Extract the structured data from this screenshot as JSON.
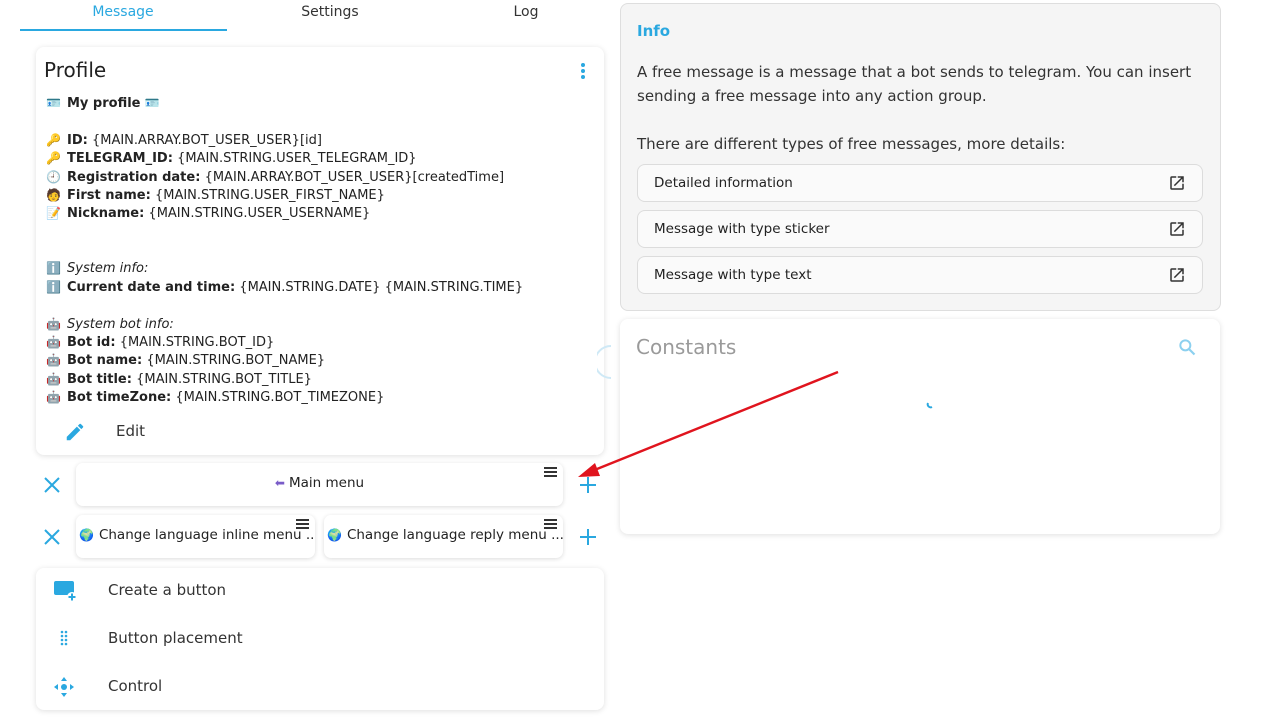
{
  "tabs": {
    "message": "Message",
    "settings": "Settings",
    "log": "Log"
  },
  "profile": {
    "title": "Profile",
    "my_profile": "My profile",
    "lines": {
      "id_label": "ID:",
      "id_value": "{MAIN.ARRAY.BOT_USER_USER}[id]",
      "tg_label": "TELEGRAM_ID:",
      "tg_value": "{MAIN.STRING.USER_TELEGRAM_ID}",
      "reg_label": "Registration date:",
      "reg_value": "{MAIN.ARRAY.BOT_USER_USER}[createdTime]",
      "first_label": "First name:",
      "first_value": "{MAIN.STRING.USER_FIRST_NAME}",
      "nick_label": "Nickname:",
      "nick_value": "{MAIN.STRING.USER_USERNAME}",
      "sys_info": "System info:",
      "cur_label": "Current date and time:",
      "cur_value": "{MAIN.STRING.DATE} {MAIN.STRING.TIME}",
      "sys_bot_info": "System bot info:",
      "botid_label": "Bot id:",
      "botid_value": "{MAIN.STRING.BOT_ID}",
      "botname_label": "Bot name:",
      "botname_value": "{MAIN.STRING.BOT_NAME}",
      "bottitle_label": "Bot title:",
      "bottitle_value": "{MAIN.STRING.BOT_TITLE}",
      "bottz_label": "Bot timeZone:",
      "bottz_value": "{MAIN.STRING.BOT_TIMEZONE}"
    },
    "edit_label": "Edit"
  },
  "keyboard": {
    "row1": {
      "button": "Main menu"
    },
    "row2": {
      "button1": "Change language inline menu ...",
      "button2": "Change language reply menu ..."
    }
  },
  "bottom_menu": {
    "create": "Create a button",
    "placement": "Button placement",
    "control": "Control"
  },
  "info": {
    "title": "Info",
    "text1": "A free message is a message that a bot sends to telegram. You can insert sending a free message into any action group.",
    "text2": "There are different types of free messages, more details:",
    "links": [
      "Detailed information",
      "Message with type sticker",
      "Message with type text"
    ]
  },
  "constants": {
    "title": "Constants"
  },
  "colors": {
    "accent": "#2aa8e0",
    "arrow": "#e0141e"
  }
}
